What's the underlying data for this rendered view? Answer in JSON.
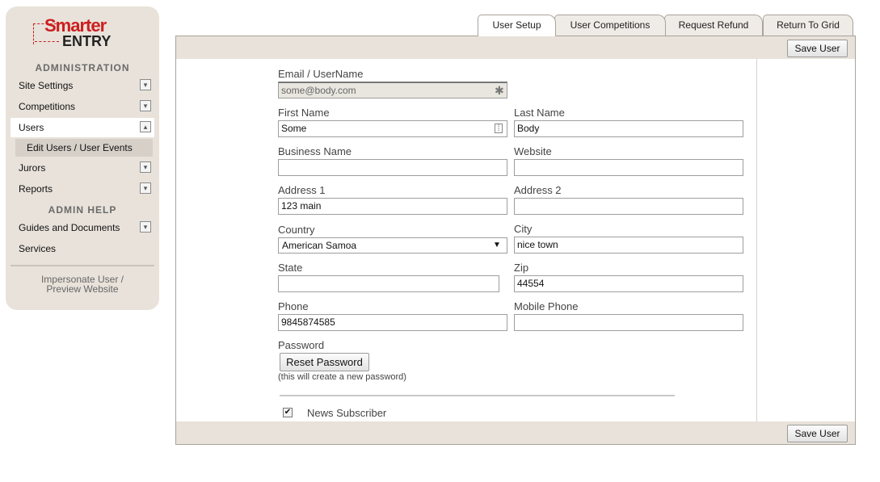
{
  "logo": {
    "line1": "Smarter",
    "line2": "ENTRY"
  },
  "sidebar": {
    "section1": "ADMINISTRATION",
    "items": [
      {
        "label": "Site Settings",
        "toggle": "▾"
      },
      {
        "label": "Competitions",
        "toggle": "▾"
      },
      {
        "label": "Users",
        "toggle": "▴"
      },
      {
        "label": "Juror s",
        "toggle": "▾"
      },
      {
        "label": "Reports",
        "toggle": "▾"
      }
    ],
    "sub_item": "Edit Users / User Events",
    "section2": "ADMIN HELP",
    "help_items": [
      {
        "label": "Guides and Documents",
        "toggle": "▾"
      },
      {
        "label": "Services"
      }
    ],
    "impersonate_line1": "Impersonate User /",
    "impersonate_line2": "Preview Website"
  },
  "tabs": [
    "User Setup",
    "User Competitions",
    "Request Refund",
    "Return To Grid"
  ],
  "toolbar": {
    "save_label": "Save User"
  },
  "form": {
    "email_label": "Email / UserName",
    "email_value": "some@body.com",
    "first_name_label": "First Name",
    "first_name_value": "Some",
    "last_name_label": "Last Name",
    "last_name_value": "Body",
    "business_label": "Business Name",
    "business_value": "",
    "website_label": "Website",
    "website_value": "",
    "address1_label": "Address 1",
    "address1_value": "123 main",
    "address2_label": "Address 2",
    "address2_value": "",
    "country_label": "Country",
    "country_value": "American Samoa",
    "city_label": "City",
    "city_value": "nice town",
    "state_label": "State",
    "state_value": "",
    "zip_label": "Zip",
    "zip_value": "44554",
    "phone_label": "Phone",
    "phone_value": "9845874585",
    "mobile_label": "Mobile Phone",
    "mobile_value": "",
    "password_label": "Password",
    "reset_button": "Reset Password",
    "password_hint": "(this will create a new password)",
    "news_label": "News Subscriber",
    "news_checked": true
  }
}
